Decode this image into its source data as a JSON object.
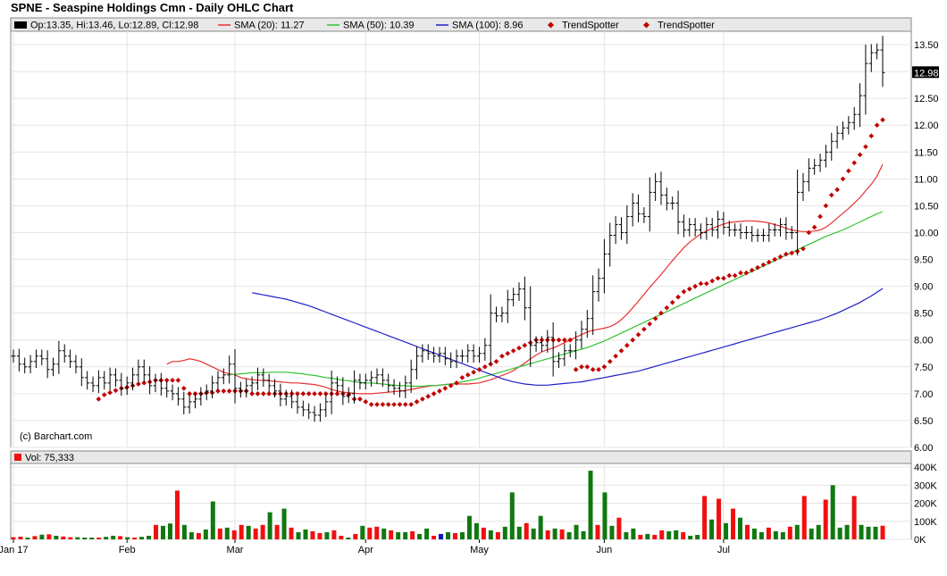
{
  "title": "SPNE - Seaspine Holdings Cmn - Daily OHLC Chart",
  "legend": {
    "ohlc": "Op:13.35, Hi:13.46, Lo:12.89, Cl:12.98",
    "sma20": "SMA (20): 11.27",
    "sma50": "SMA (50): 10.39",
    "sma100": "SMA (100): 8.96",
    "trend1": "TrendSpotter",
    "trend2": "TrendSpotter"
  },
  "watermark": "(c) Barchart.com",
  "last_price_tag": "12.98",
  "volume_label": "Vol: 75,333",
  "colors": {
    "sma20": "#e83030",
    "sma50": "#33c233",
    "sma100": "#2020c8",
    "trend": "#c00000",
    "vol_up": "#107810",
    "vol_down": "#f01010",
    "vol_flat": "#1010c0"
  },
  "chart_data": [
    {
      "type": "ohlc",
      "title": "SPNE - Seaspine Holdings Cmn - Daily OHLC Chart",
      "xlabel": "",
      "ylabel": "",
      "ylim": [
        6.0,
        13.75
      ],
      "y_ticks": [
        "6.00",
        "6.50",
        "7.00",
        "7.50",
        "8.00",
        "8.50",
        "9.00",
        "9.50",
        "10.00",
        "10.50",
        "11.00",
        "11.50",
        "12.00",
        "12.50",
        "13.00",
        "13.50"
      ],
      "x_ticks": [
        "Jan 17",
        "Feb",
        "Mar",
        "Apr",
        "May",
        "Jun",
        "Jul"
      ],
      "x_tick_index": [
        0,
        20,
        39,
        62,
        82,
        104,
        125
      ],
      "grid": true,
      "legend_position": "top",
      "close": [
        7.7,
        7.55,
        7.5,
        7.6,
        7.7,
        7.65,
        7.45,
        7.55,
        7.8,
        7.7,
        7.6,
        7.5,
        7.3,
        7.2,
        7.15,
        7.3,
        7.2,
        7.35,
        7.25,
        7.1,
        7.2,
        7.35,
        7.5,
        7.35,
        7.15,
        7.25,
        7.1,
        7.05,
        7.0,
        6.9,
        6.75,
        6.85,
        6.9,
        7.0,
        7.05,
        7.2,
        7.3,
        7.35,
        7.55,
        7.1,
        7.05,
        7.15,
        7.2,
        7.35,
        7.25,
        7.15,
        7.05,
        6.9,
        6.95,
        6.85,
        6.75,
        6.7,
        6.65,
        6.6,
        6.7,
        6.85,
        7.2,
        7.15,
        6.95,
        7.0,
        7.25,
        7.2,
        7.25,
        7.3,
        7.35,
        7.25,
        7.15,
        7.1,
        7.05,
        7.2,
        7.45,
        7.7,
        7.8,
        7.75,
        7.7,
        7.75,
        7.65,
        7.6,
        7.7,
        7.7,
        7.8,
        7.7,
        7.75,
        7.9,
        8.5,
        8.45,
        8.5,
        8.75,
        8.85,
        8.95,
        8.6,
        7.9,
        7.95,
        7.9,
        8.05,
        7.6,
        7.65,
        7.8,
        7.8,
        8.0,
        8.2,
        8.4,
        8.9,
        9.15,
        9.6,
        9.95,
        10.15,
        10.0,
        10.3,
        10.55,
        10.35,
        10.3,
        10.75,
        10.95,
        10.7,
        10.55,
        10.55,
        10.2,
        10.05,
        10.15,
        10.05,
        10.0,
        10.15,
        10.05,
        10.25,
        10.1,
        10.05,
        10.05,
        10.0,
        10.0,
        9.95,
        9.95,
        9.95,
        10.05,
        10.05,
        10.15,
        10.0,
        10.0,
        10.75,
        10.95,
        11.2,
        11.25,
        11.35,
        11.5,
        11.7,
        11.85,
        11.95,
        12.05,
        12.2,
        12.55,
        13.15,
        13.35,
        13.4,
        12.98
      ],
      "series": [
        {
          "name": "SMA (20): 11.27",
          "values": [
            7.55,
            7.6,
            7.6,
            7.62,
            7.65,
            7.63,
            7.6,
            7.55,
            7.5,
            7.45,
            7.4,
            7.37,
            7.35,
            7.3,
            7.28,
            7.26,
            7.25,
            7.25,
            7.24,
            7.23,
            7.22,
            7.21,
            7.2,
            7.2,
            7.19,
            7.18,
            7.17,
            7.15,
            7.12,
            7.08,
            7.05,
            7.03,
            7.02,
            7.01,
            7.0,
            7.0,
            7.0,
            7.01,
            7.02,
            7.03,
            7.04,
            7.05,
            7.06,
            7.08,
            7.1,
            7.12,
            7.14,
            7.15,
            7.16,
            7.17,
            7.18,
            7.18,
            7.18,
            7.18,
            7.19,
            7.2,
            7.23,
            7.26,
            7.3,
            7.34,
            7.38,
            7.43,
            7.5,
            7.57,
            7.65,
            7.72,
            7.78,
            7.82,
            7.85,
            7.9,
            7.95,
            8.0,
            8.05,
            8.1,
            8.15,
            8.18,
            8.2,
            8.22,
            8.25,
            8.3,
            8.38,
            8.48,
            8.6,
            8.72,
            8.85,
            8.98,
            9.1,
            9.22,
            9.35,
            9.48,
            9.6,
            9.72,
            9.82,
            9.9,
            9.98,
            10.03,
            10.08,
            10.12,
            10.16,
            10.19,
            10.2,
            10.21,
            10.22,
            10.22,
            10.21,
            10.2,
            10.18,
            10.15,
            10.12,
            10.08,
            10.05,
            10.03,
            10.02,
            10.02,
            10.03,
            10.05,
            10.1,
            10.18,
            10.27,
            10.36,
            10.45,
            10.55,
            10.65,
            10.78,
            10.9,
            11.05,
            11.27
          ]
        },
        {
          "name": "SMA (50): 10.39",
          "values": [
            7.35,
            7.36,
            7.37,
            7.38,
            7.39,
            7.39,
            7.39,
            7.4,
            7.4,
            7.4,
            7.4,
            7.39,
            7.38,
            7.37,
            7.35,
            7.34,
            7.32,
            7.3,
            7.29,
            7.27,
            7.25,
            7.24,
            7.22,
            7.21,
            7.2,
            7.2,
            7.19,
            7.18,
            7.17,
            7.16,
            7.15,
            7.15,
            7.14,
            7.14,
            7.14,
            7.15,
            7.15,
            7.16,
            7.17,
            7.18,
            7.2,
            7.22,
            7.24,
            7.26,
            7.29,
            7.32,
            7.35,
            7.38,
            7.41,
            7.44,
            7.47,
            7.5,
            7.53,
            7.56,
            7.59,
            7.62,
            7.65,
            7.68,
            7.71,
            7.74,
            7.77,
            7.8,
            7.83,
            7.86,
            7.9,
            7.94,
            7.98,
            8.03,
            8.08,
            8.13,
            8.18,
            8.23,
            8.28,
            8.33,
            8.38,
            8.43,
            8.48,
            8.53,
            8.58,
            8.63,
            8.68,
            8.73,
            8.78,
            8.83,
            8.88,
            8.93,
            8.98,
            9.03,
            9.08,
            9.13,
            9.18,
            9.23,
            9.28,
            9.33,
            9.38,
            9.43,
            9.48,
            9.53,
            9.58,
            9.63,
            9.68,
            9.73,
            9.78,
            9.83,
            9.88,
            9.93,
            9.97,
            10.01,
            10.05,
            10.1,
            10.15,
            10.2,
            10.25,
            10.3,
            10.35,
            10.39
          ]
        },
        {
          "name": "SMA (100): 8.96",
          "values": [
            8.88,
            8.86,
            8.84,
            8.82,
            8.8,
            8.78,
            8.76,
            8.73,
            8.7,
            8.67,
            8.64,
            8.6,
            8.56,
            8.52,
            8.48,
            8.44,
            8.4,
            8.36,
            8.32,
            8.28,
            8.24,
            8.2,
            8.16,
            8.12,
            8.08,
            8.04,
            8.0,
            7.96,
            7.92,
            7.88,
            7.84,
            7.8,
            7.76,
            7.72,
            7.68,
            7.64,
            7.6,
            7.56,
            7.52,
            7.48,
            7.44,
            7.4,
            7.36,
            7.32,
            7.28,
            7.25,
            7.22,
            7.2,
            7.18,
            7.17,
            7.16,
            7.16,
            7.16,
            7.17,
            7.18,
            7.19,
            7.2,
            7.21,
            7.22,
            7.24,
            7.26,
            7.28,
            7.3,
            7.32,
            7.34,
            7.36,
            7.38,
            7.4,
            7.42,
            7.45,
            7.48,
            7.51,
            7.54,
            7.57,
            7.6,
            7.63,
            7.66,
            7.69,
            7.72,
            7.75,
            7.78,
            7.81,
            7.84,
            7.87,
            7.9,
            7.93,
            7.96,
            7.99,
            8.02,
            8.05,
            8.08,
            8.11,
            8.14,
            8.17,
            8.2,
            8.23,
            8.26,
            8.29,
            8.32,
            8.35,
            8.38,
            8.42,
            8.46,
            8.5,
            8.55,
            8.6,
            8.65,
            8.7,
            8.76,
            8.82,
            8.89,
            8.96
          ]
        },
        {
          "name": "TrendSpotter",
          "values": [
            6.9,
            6.98,
            7.02,
            7.06,
            7.1,
            7.12,
            7.15,
            7.18,
            7.2,
            7.22,
            7.25,
            7.25,
            7.25,
            7.25,
            7.25,
            7.1,
            7.0,
            7.0,
            7.0,
            7.02,
            7.02,
            7.05,
            7.05,
            7.05,
            7.05,
            7.05,
            7.05,
            7.0,
            7.0,
            7.0,
            7.0,
            7.0,
            7.0,
            7.0,
            7.0,
            7.0,
            7.0,
            7.0,
            7.0,
            7.0,
            7.0,
            7.0,
            7.0,
            7.0,
            6.98,
            6.9,
            6.9,
            6.85,
            6.8,
            6.8,
            6.8,
            6.8,
            6.8,
            6.8,
            6.8,
            6.8,
            6.85,
            6.9,
            6.95,
            7.0,
            7.05,
            7.1,
            7.15,
            7.2,
            7.3,
            7.35,
            7.4,
            7.45,
            7.5,
            7.55,
            7.6,
            7.7,
            7.75,
            7.8,
            7.85,
            7.9,
            7.95,
            8.0,
            8.0,
            8.0,
            8.0,
            8.0,
            8.0,
            8.0,
            7.45,
            7.5,
            7.5,
            7.45,
            7.45,
            7.5,
            7.6,
            7.7,
            7.8,
            7.9,
            8.0,
            8.1,
            8.2,
            8.3,
            8.4,
            8.5,
            8.6,
            8.7,
            8.8,
            8.9,
            8.95,
            9.0,
            9.05,
            9.05,
            9.1,
            9.15,
            9.15,
            9.2,
            9.2,
            9.25,
            9.25,
            9.3,
            9.35,
            9.4,
            9.45,
            9.5,
            9.55,
            9.6,
            9.62,
            9.65,
            9.7,
            10.0,
            10.1,
            10.3,
            10.5,
            10.7,
            10.8,
            11.0,
            11.15,
            11.3,
            11.45,
            11.6,
            11.8,
            12.0,
            12.1
          ]
        },
        {
          "name": "TrendSpotter",
          "values": []
        }
      ]
    },
    {
      "type": "bar",
      "title": "Vol: 75,333",
      "ylim": [
        0,
        420000
      ],
      "y_ticks": [
        "0K",
        "100K",
        "200K",
        "300K",
        "400K"
      ],
      "values": [
        12000,
        15000,
        10000,
        18000,
        26000,
        28000,
        20000,
        16000,
        12000,
        12000,
        10000,
        10000,
        10000,
        14000,
        20000,
        18000,
        12000,
        10000,
        14000,
        20000,
        80000,
        75000,
        88000,
        270000,
        80000,
        40000,
        35000,
        55000,
        210000,
        60000,
        65000,
        50000,
        80000,
        75000,
        60000,
        80000,
        150000,
        80000,
        170000,
        65000,
        40000,
        55000,
        45000,
        35000,
        40000,
        50000,
        20000,
        10000,
        30000,
        75000,
        65000,
        70000,
        60000,
        50000,
        40000,
        40000,
        45000,
        30000,
        60000,
        20000,
        30000,
        40000,
        35000,
        40000,
        130000,
        90000,
        65000,
        50000,
        40000,
        70000,
        260000,
        70000,
        90000,
        60000,
        130000,
        50000,
        60000,
        55000,
        40000,
        80000,
        45000,
        380000,
        80000,
        260000,
        75000,
        120000,
        40000,
        60000,
        25000,
        30000,
        25000,
        50000,
        45000,
        50000,
        40000,
        20000,
        25000,
        240000,
        110000,
        225000,
        90000,
        170000,
        120000,
        80000,
        60000,
        40000,
        65000,
        45000,
        40000,
        70000,
        80000,
        240000,
        60000,
        80000,
        220000,
        300000,
        65000,
        80000,
        240000,
        80000,
        70000,
        70000,
        75333
      ],
      "colors": [
        "down",
        "down",
        "up",
        "down",
        "up",
        "down",
        "up",
        "down",
        "down",
        "up",
        "up",
        "up",
        "down",
        "up",
        "up",
        "down",
        "up",
        "down",
        "up",
        "up",
        "down",
        "up",
        "up",
        "down",
        "up",
        "up",
        "down",
        "up",
        "up",
        "down",
        "up",
        "down",
        "down",
        "up",
        "down",
        "down",
        "up",
        "down",
        "up",
        "down",
        "up",
        "up",
        "down",
        "down",
        "up",
        "down",
        "down",
        "up",
        "down",
        "up",
        "down",
        "down",
        "up",
        "down",
        "up",
        "up",
        "down",
        "up",
        "up",
        "down",
        "flat",
        "up",
        "down",
        "up",
        "up",
        "up",
        "down",
        "up",
        "down",
        "up",
        "up",
        "up",
        "down",
        "up",
        "up",
        "down",
        "up",
        "down",
        "up",
        "up",
        "up",
        "up",
        "down",
        "up",
        "up",
        "down",
        "up",
        "up",
        "down",
        "up",
        "down",
        "down",
        "up",
        "up",
        "down",
        "up",
        "up",
        "down",
        "up",
        "down",
        "up",
        "down",
        "up",
        "down",
        "up",
        "up",
        "down",
        "up",
        "up",
        "down",
        "up",
        "down",
        "up",
        "up",
        "down",
        "up",
        "up",
        "up",
        "down",
        "up",
        "up",
        "up",
        "down"
      ]
    }
  ]
}
